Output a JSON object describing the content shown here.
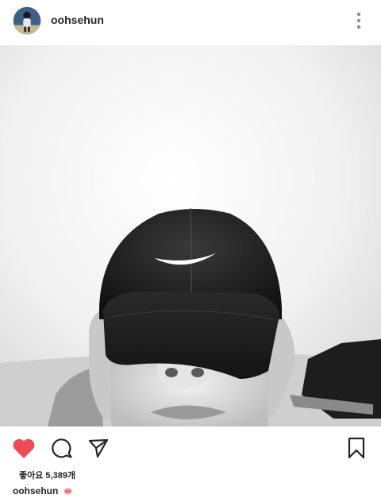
{
  "post": {
    "username": "oohsehun",
    "likes_text": "좋아요 5,389개",
    "caption_username": "oohsehun",
    "caption_emoji": "pig-nose-emoji"
  },
  "icons": {
    "more": "more-vertical-icon",
    "like": "heart-filled-icon",
    "comment": "comment-icon",
    "share": "send-icon",
    "save": "bookmark-icon"
  },
  "colors": {
    "like": "#ed4956",
    "text": "#262626",
    "emoji": "#f5a7b0"
  }
}
